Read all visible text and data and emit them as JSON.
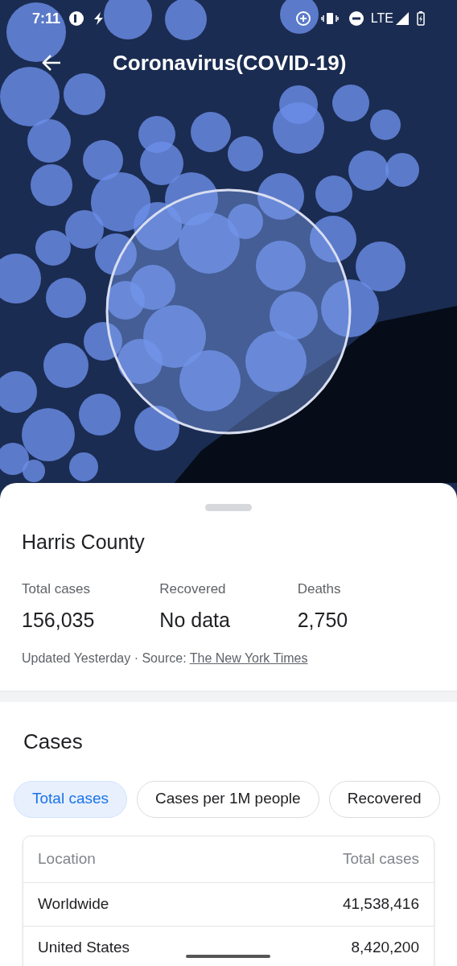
{
  "status_bar": {
    "time": "7:11",
    "network": "LTE"
  },
  "app_bar": {
    "title": "Coronavirus(COVID-19)"
  },
  "summary": {
    "place": "Harris County",
    "stats": [
      {
        "label": "Total cases",
        "value": "156,035"
      },
      {
        "label": "Recovered",
        "value": "No data"
      },
      {
        "label": "Deaths",
        "value": "2,750"
      }
    ],
    "updated": "Updated Yesterday · Source:",
    "source_link": "The New York Times"
  },
  "cases": {
    "title": "Cases",
    "chips": [
      {
        "label": "Total cases",
        "selected": true
      },
      {
        "label": "Cases per 1M people",
        "selected": false
      },
      {
        "label": "Recovered",
        "selected": false
      }
    ],
    "table": {
      "columns": [
        "Location",
        "Total cases"
      ],
      "rows": [
        [
          "Worldwide",
          "41,538,416"
        ],
        [
          "United States",
          "8,420,200"
        ]
      ]
    }
  }
}
